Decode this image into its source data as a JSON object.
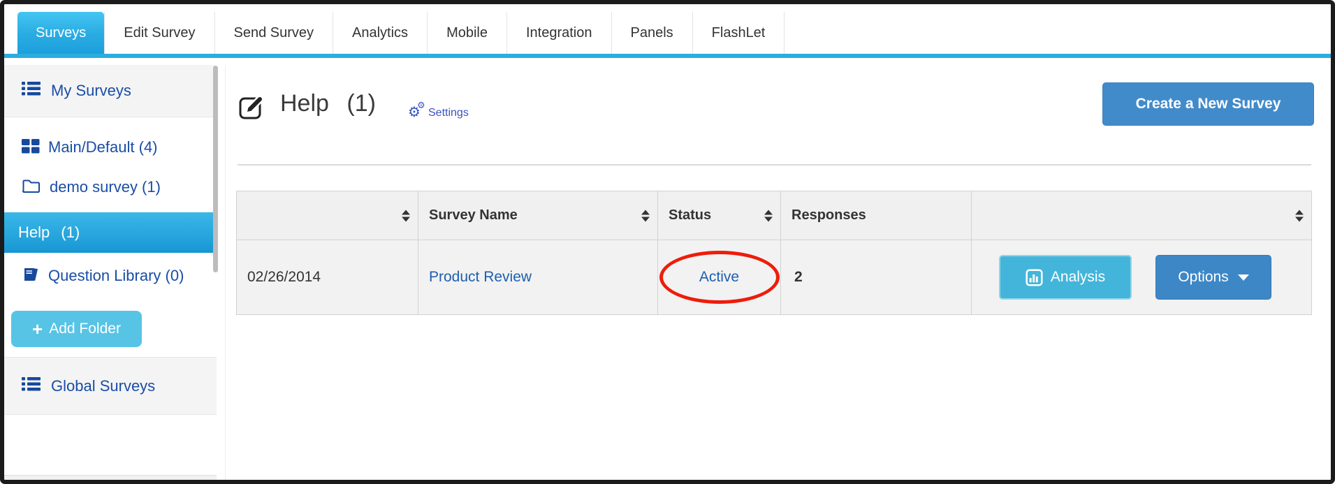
{
  "nav": {
    "tabs": [
      {
        "label": "Surveys",
        "active": true
      },
      {
        "label": "Edit Survey",
        "active": false
      },
      {
        "label": "Send Survey",
        "active": false
      },
      {
        "label": "Analytics",
        "active": false
      },
      {
        "label": "Mobile",
        "active": false
      },
      {
        "label": "Integration",
        "active": false
      },
      {
        "label": "Panels",
        "active": false
      },
      {
        "label": "FlashLet",
        "active": false
      }
    ]
  },
  "sidebar": {
    "my_surveys_label": "My Surveys",
    "folders": [
      {
        "label": "Main/Default (4)",
        "icon": "grid-icon",
        "selected": false
      },
      {
        "label": "demo survey (1)",
        "icon": "folder-icon",
        "selected": false
      },
      {
        "label": "Help (1)",
        "icon": "none",
        "selected": true
      },
      {
        "label": "Question Library (0)",
        "icon": "book-icon",
        "selected": false
      }
    ],
    "add_folder": {
      "plus": "+",
      "label": "Add Folder"
    },
    "global_surveys_label": "Global Surveys"
  },
  "main": {
    "title": "Help (1)",
    "settings_label": "Settings",
    "create_button_label": "Create a New Survey",
    "table": {
      "headers": [
        {
          "label": "",
          "sortable": true
        },
        {
          "label": "Survey Name",
          "sortable": true
        },
        {
          "label": "Status",
          "sortable": true
        },
        {
          "label": "Responses",
          "sortable": false
        },
        {
          "label": "",
          "sortable": true
        }
      ],
      "rows": [
        {
          "date": "02/26/2014",
          "survey_name": "Product Review",
          "status": "Active",
          "status_circled": true,
          "responses": "2",
          "analysis_label": "Analysis",
          "options_label": "Options"
        }
      ]
    }
  },
  "colors": {
    "accent_blue": "#29abe2",
    "primary_button_blue": "#428bca",
    "info_button_cyan": "#44b5da",
    "sidebar_link_navy": "#1a4da6",
    "table_link_blue": "#1d5fae",
    "annotation_red": "#ee1c0b"
  }
}
